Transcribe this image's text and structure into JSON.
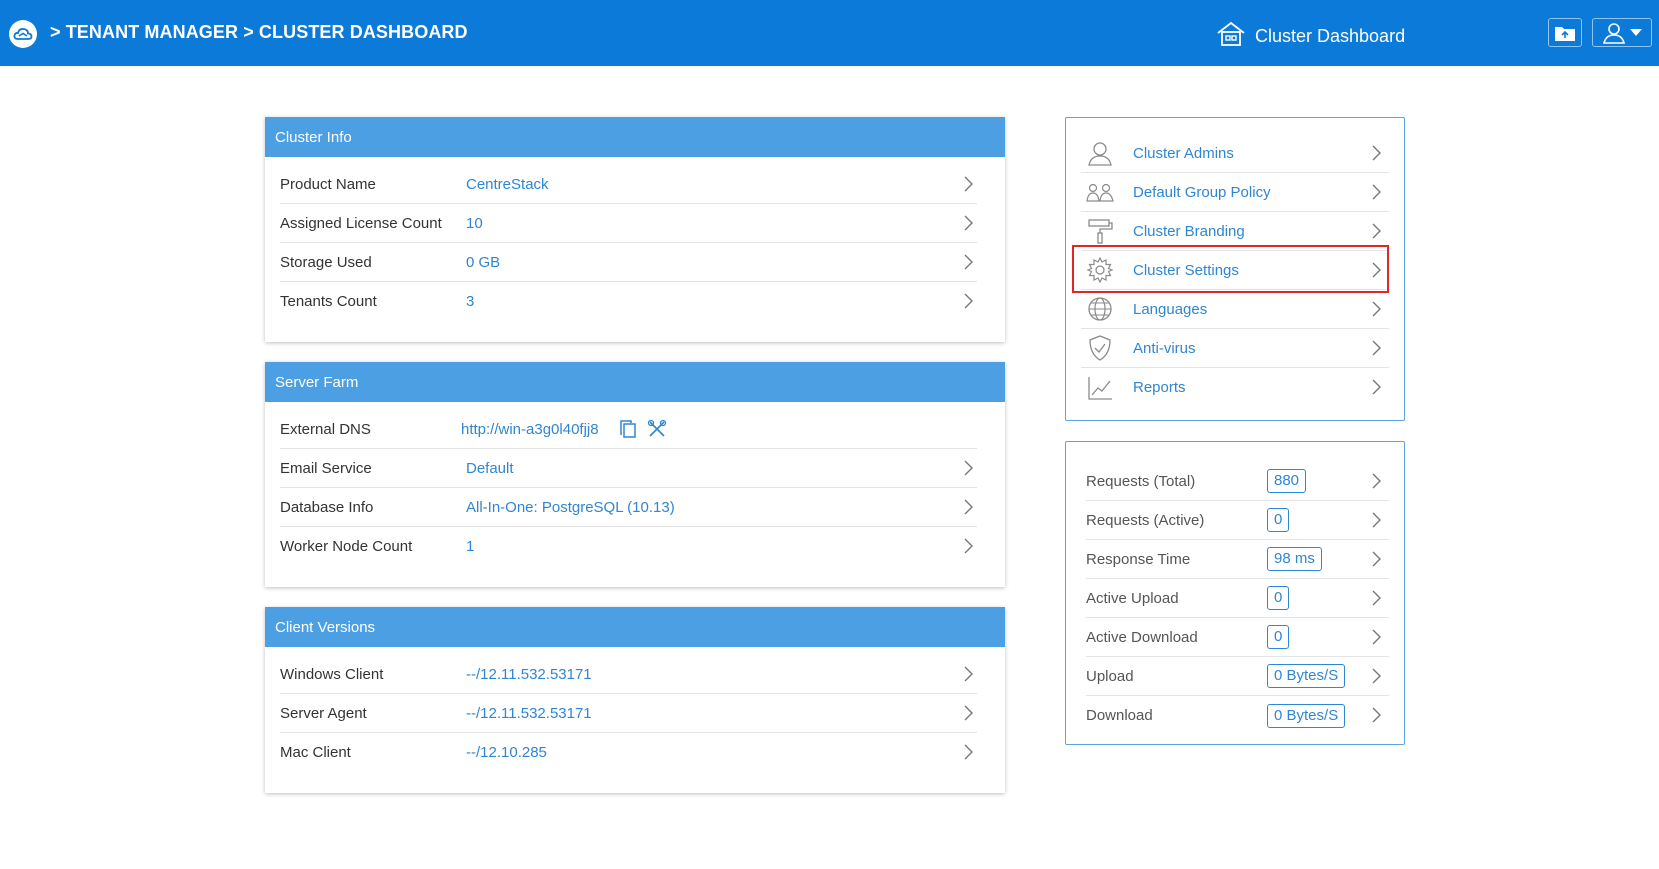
{
  "header": {
    "breadcrumb": "> TENANT MANAGER > CLUSTER DASHBOARD",
    "page_title": "Cluster Dashboard"
  },
  "cluster_info": {
    "title": "Cluster Info",
    "rows": [
      {
        "label": "Product Name",
        "value": "CentreStack"
      },
      {
        "label": "Assigned License Count",
        "value": "10"
      },
      {
        "label": "Storage Used",
        "value": "0 GB"
      },
      {
        "label": "Tenants Count",
        "value": "3"
      }
    ]
  },
  "server_farm": {
    "title": "Server Farm",
    "rows": [
      {
        "label": "External DNS",
        "value": "http://win-a3g0l40fjj8"
      },
      {
        "label": "Email Service",
        "value": "Default"
      },
      {
        "label": "Database Info",
        "value": "All-In-One: PostgreSQL (10.13)"
      },
      {
        "label": "Worker Node Count",
        "value": "1"
      }
    ]
  },
  "client_versions": {
    "title": "Client Versions",
    "rows": [
      {
        "label": "Windows Client",
        "value": "--/12.11.532.53171"
      },
      {
        "label": "Server Agent",
        "value": "--/12.11.532.53171"
      },
      {
        "label": "Mac Client",
        "value": "--/12.10.285"
      }
    ]
  },
  "menu": {
    "items": [
      {
        "label": "Cluster Admins",
        "icon": "admin-user-icon"
      },
      {
        "label": "Default Group Policy",
        "icon": "group-policy-icon"
      },
      {
        "label": "Cluster Branding",
        "icon": "paint-roller-icon"
      },
      {
        "label": "Cluster Settings",
        "icon": "gear-icon"
      },
      {
        "label": "Languages",
        "icon": "globe-icon"
      },
      {
        "label": "Anti-virus",
        "icon": "shield-icon"
      },
      {
        "label": "Reports",
        "icon": "chart-icon"
      }
    ]
  },
  "stats": {
    "rows": [
      {
        "label": "Requests (Total)",
        "value": "880"
      },
      {
        "label": "Requests (Active)",
        "value": "0"
      },
      {
        "label": "Response Time",
        "value": "98 ms"
      },
      {
        "label": "Active Upload",
        "value": "0"
      },
      {
        "label": "Active Download",
        "value": "0"
      },
      {
        "label": "Upload",
        "value": "0 Bytes/S"
      },
      {
        "label": "Download",
        "value": "0 Bytes/S"
      }
    ]
  },
  "colors": {
    "topbar": "#0b7ad8",
    "panel_header": "#4b9fe2",
    "link": "#2f86d2",
    "highlight": "#e02727"
  }
}
